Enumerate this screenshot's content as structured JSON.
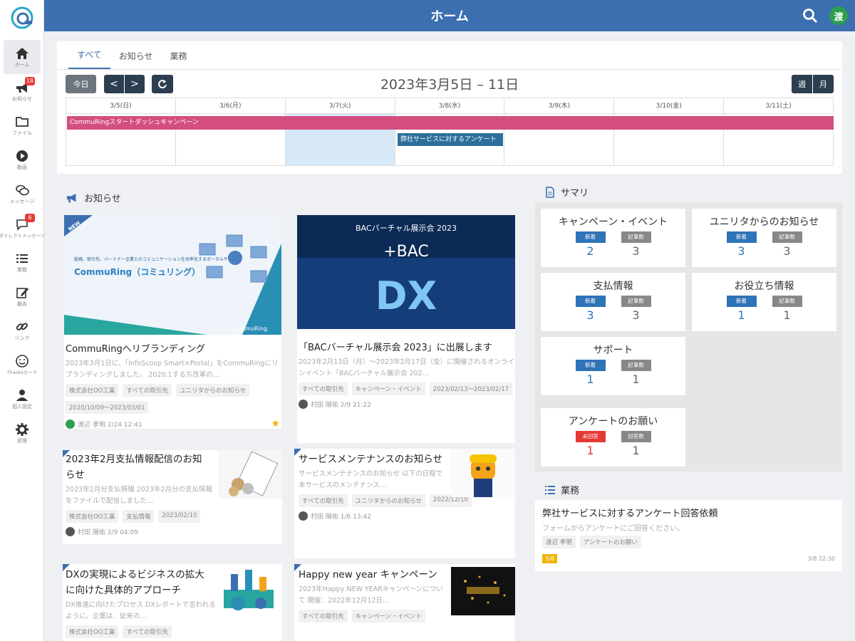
{
  "app": {
    "title": "ホーム",
    "user_initial": "渡"
  },
  "sidebar": {
    "items": [
      {
        "label": "ホーム",
        "icon": "home-icon",
        "badge": ""
      },
      {
        "label": "お知らせ",
        "icon": "megaphone-icon",
        "badge": "18"
      },
      {
        "label": "ファイル",
        "icon": "folder-icon",
        "badge": ""
      },
      {
        "label": "動画",
        "icon": "play-icon",
        "badge": ""
      },
      {
        "label": "メッセージ",
        "icon": "chat-icon",
        "badge": ""
      },
      {
        "label": "ダイレクトメッセージ",
        "icon": "direct-message-icon",
        "badge": "6"
      },
      {
        "label": "業務",
        "icon": "task-list-icon",
        "badge": ""
      },
      {
        "label": "報告",
        "icon": "edit-icon",
        "badge": ""
      },
      {
        "label": "リンク",
        "icon": "link-icon",
        "badge": ""
      },
      {
        "label": "Thanksカード",
        "icon": "smile-icon",
        "badge": ""
      },
      {
        "label": "個人設定",
        "icon": "person-icon",
        "badge": ""
      },
      {
        "label": "管理",
        "icon": "gear-icon",
        "badge": ""
      }
    ]
  },
  "calendar": {
    "tabs": [
      "すべて",
      "お知らせ",
      "業務"
    ],
    "today_label": "今日",
    "prev_label": "<",
    "next_label": ">",
    "title": "2023年3月5日 – 11日",
    "week_label": "週",
    "month_label": "月",
    "days": [
      "3/5(日)",
      "3/6(月)",
      "3/7(火)",
      "3/8(水)",
      "3/9(木)",
      "3/10(金)",
      "3/11(土)"
    ],
    "events": [
      {
        "label": "CommuRingスタートダッシュキャンペーン",
        "color": "#d44e7f"
      },
      {
        "label": "弊社サービスに対するアンケート",
        "color": "#2c6f9b"
      }
    ]
  },
  "news": {
    "section_title": "お知らせ",
    "cards": [
      {
        "title": "CommuRingへリブランディング",
        "text": "2023年3月1日に、「InfoScoop Smart×Portal」をCommuRingにリブランディングしました。 2020.1する方改革の…",
        "tags": [
          "株式会社OO工業",
          "すべての取引先",
          "ユニリタからのお知らせ",
          "2020/10/09～2023/03/01"
        ],
        "author": "渡辺 孝明 2/24 12:41",
        "img_heading": "総務、取引先、パートナー企業とのコミュニケーションを効率化するポータルサイト",
        "img_brand": "CommuRing（コミュリング）",
        "img_badge": "NEW",
        "img_logo": "CommuRing"
      },
      {
        "title": "「BACバーチャル展示会 2023」に出展します",
        "text": "2023年2月13日（月）～2023年2月17日（金）に開催されるオンラインイベント「BACバーチャル展示会 202…",
        "tags": [
          "すべての取引先",
          "キャンペーン・イベント",
          "2023/02/13～2023/02/17"
        ],
        "author": "村田 陽佑 2/9 21:22",
        "img_heading": "BACバーチャル展示会 2023",
        "img_sub": "+BAC",
        "img_big": "DX"
      },
      {
        "title": "2023年2月支払情報配信のお知らせ",
        "text": "2023年2月分支払情報 2023年2月分の支払情報をファイルで配信しました…",
        "tags": [
          "株式会社OO工業",
          "支払情報",
          "2023/02/10"
        ],
        "author": "村田 陽佑 2/9 04:09"
      },
      {
        "title": "サービスメンテナンスのお知らせ",
        "text": "サービスメンテナンスのお知らせ 以下の日程で本サービスのメンテナンス…",
        "tags": [
          "すべての取引先",
          "ユニリタからのお知らせ",
          "2022/12/10"
        ],
        "author": "村田 陽佑 1/6 13:42"
      },
      {
        "title": "DXの実現によるビジネスの拡大に向けた具体的アプローチ",
        "text": "DX推進に向けたプロセス DXレポートで言われるように、企業は、従来の…",
        "tags": [
          "株式会社OO工業",
          "すべての取引先"
        ]
      },
      {
        "title": "Happy new year キャンペーン",
        "text": "2023年Happy NEW YEARキャンペーンについて 開催：2022年12月12日…",
        "tags": [
          "すべての取引先",
          "キャンペーン・イベント"
        ]
      }
    ]
  },
  "summary": {
    "section_title": "サマリ",
    "cards": [
      {
        "title": "キャンペーン・イベント",
        "label_a": "新着",
        "label_b": "記事数",
        "a": "2",
        "b": "3"
      },
      {
        "title": "ユニリタからのお知らせ",
        "label_a": "新着",
        "label_b": "記事数",
        "a": "3",
        "b": "3"
      },
      {
        "title": "支払情報",
        "label_a": "新着",
        "label_b": "記事数",
        "a": "3",
        "b": "3"
      },
      {
        "title": "お役立ち情報",
        "label_a": "新着",
        "label_b": "記事数",
        "a": "1",
        "b": "1"
      },
      {
        "title": "サポート",
        "label_a": "新着",
        "label_b": "記事数",
        "a": "1",
        "b": "1"
      },
      {
        "title": "アンケートのお願い",
        "label_a": "未回答",
        "label_b": "回答数",
        "a": "1",
        "b": "1"
      }
    ]
  },
  "tasks": {
    "section_title": "業務",
    "item": {
      "title": "弊社サービスに対するアンケート回答依頼",
      "text": "フォームからアンケートにご回答ください。",
      "tags": [
        "渡辺 孝明",
        "アンケートのお願い"
      ],
      "badge": "3/8",
      "time": "3/8 22:30"
    }
  }
}
